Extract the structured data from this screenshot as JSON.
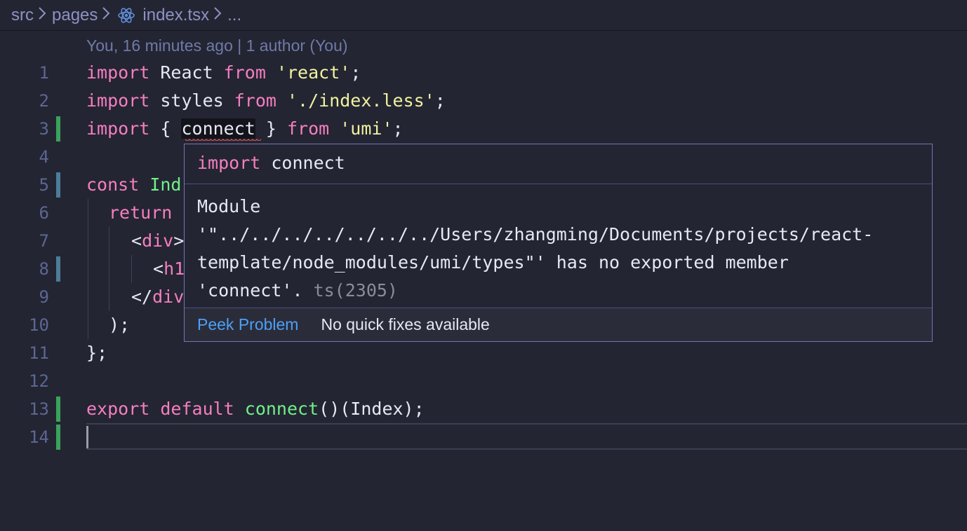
{
  "breadcrumb": {
    "items": [
      "src",
      "pages",
      "index.tsx",
      "..."
    ],
    "separator_icon": "chevron-right-icon",
    "file_icon": "react-icon"
  },
  "blame": {
    "text": "You, 16 minutes ago | 1 author (You)"
  },
  "lines": [
    {
      "num": "1"
    },
    {
      "num": "2"
    },
    {
      "num": "3"
    },
    {
      "num": "4"
    },
    {
      "num": "5"
    },
    {
      "num": "6"
    },
    {
      "num": "7"
    },
    {
      "num": "8"
    },
    {
      "num": "9"
    },
    {
      "num": "10"
    },
    {
      "num": "11"
    },
    {
      "num": "12"
    },
    {
      "num": "13"
    },
    {
      "num": "14"
    }
  ],
  "code": {
    "l1": {
      "kw1": "import",
      "id": " React ",
      "kw2": "from",
      "str": " 'react'",
      "end": ";"
    },
    "l2": {
      "kw1": "import",
      "id": " styles ",
      "kw2": "from",
      "str": " './index.less'",
      "end": ";"
    },
    "l3": {
      "kw1": "import",
      "open": " { ",
      "id": "connect",
      "close": " } ",
      "kw2": "from",
      "str": " 'umi'",
      "end": ";"
    },
    "l5": {
      "kw": "const",
      "name": " Ind"
    },
    "l6": {
      "kw": "return"
    },
    "l7": {
      "open": "<",
      "tag": "div",
      "close": ">"
    },
    "l8": {
      "open": "<",
      "tag": "h1"
    },
    "l9": {
      "open": "</",
      "tag": "div"
    },
    "l10": {
      "text": ");"
    },
    "l11": {
      "text": "};"
    },
    "l13": {
      "kw1": "export",
      "kw2": " default ",
      "fn": "connect",
      "rest": "()(Index);"
    }
  },
  "hover": {
    "signature_kw": "import",
    "signature_id": " connect",
    "message_lines": [
      "Module",
      "'\"../../../../../../../Users/zhangming/Documents/projects/react-",
      "template/node_modules/umi/types\"' has no exported member"
    ],
    "message_last": "'connect'.",
    "code_ref": " ts(2305)",
    "peek_label": "Peek Problem",
    "nofix_label": "No quick fixes available"
  },
  "colors": {
    "background": "#242532",
    "keyword": "#f47fc0",
    "string": "#f1f1a0",
    "function": "#6ff08b",
    "line_number": "#5c6694",
    "link": "#4ca0f5",
    "gutter_added": "#3aa35b",
    "gutter_modified": "#4b7d99",
    "error_squiggle": "#e05252"
  }
}
